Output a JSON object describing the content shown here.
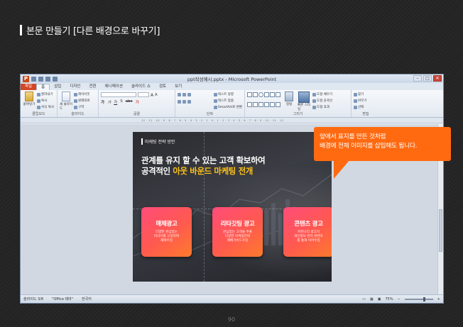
{
  "page_header": {
    "title": "본문 만들기 [다른 배경으로 바꾸기]"
  },
  "page_number": "90",
  "window": {
    "title": "ppt작성예시.pptx - Microsoft PowerPoint",
    "controls": {
      "minimize": "–",
      "maximize": "□",
      "close": "✕"
    }
  },
  "tabs": [
    "파일",
    "홈",
    "삽입",
    "디자인",
    "전환",
    "애니메이션",
    "슬라이드 쇼",
    "검토",
    "보기"
  ],
  "ribbon": {
    "clipboard": {
      "paste": "붙여넣기",
      "cut": "잘라내기",
      "copy": "복사",
      "format": "서식 복사",
      "label": "클립보드"
    },
    "slides": {
      "new_slide": "새 슬라이드",
      "layout": "레이아웃",
      "reset": "원래대로",
      "section": "구역",
      "label": "슬라이드"
    },
    "font": {
      "label": "글꼴"
    },
    "paragraph": {
      "text_direction": "텍스트 방향",
      "align_text": "텍스트 맞춤",
      "smartart": "SmartArt로 변환",
      "label": "단락"
    },
    "drawing": {
      "arrange": "정렬",
      "quick_styles": "빠른 스타일",
      "fill": "도형 채우기",
      "outline": "도형 윤곽선",
      "effects": "도형 효과",
      "label": "그리기"
    },
    "editing": {
      "find": "찾기",
      "replace": "바꾸기",
      "select": "선택",
      "label": "편집"
    }
  },
  "ruler_text": "12 · 11 · 10 · 9 · 8 · 7 · 6 · 5 · 4 · 3 · 2 · 1 · 0 · 1 · 2 · 3 · 4 · 5 · 6 · 7 · 8 · 9 · 10 · 11 · 12",
  "slide": {
    "subtitle": "마케팅 전략 방안",
    "headline_line1": "관계를 유지 할 수 있는 고객 확보하여",
    "headline_line2_prefix": "공격적인 ",
    "headline_line2_highlight": "아웃 바운드 마케팅 전개",
    "cards": [
      {
        "title": "매체광고",
        "desc": "다양한 관심있는\n미디어를 선정하여\n재배수집"
      },
      {
        "title": "리타깃팅 광고",
        "desc": "관심있는 고객을 추출\n다양한 마케팅전략\n재배가이드수집"
      },
      {
        "title": "콘텐츠 광고",
        "desc": "커뮤니티 광고지\n개인정보 관리 콘텐츠\n를 통해 이어수집"
      }
    ]
  },
  "statusbar": {
    "slide_info": "슬라이드 3/8",
    "theme": "\"Office 테마\"",
    "language": "한국어",
    "zoom": "75%"
  },
  "callout": {
    "text": "앞에서 표지를 만든 것처럼\n배경에 전체 이미지를 삽입해도 됩니다."
  }
}
